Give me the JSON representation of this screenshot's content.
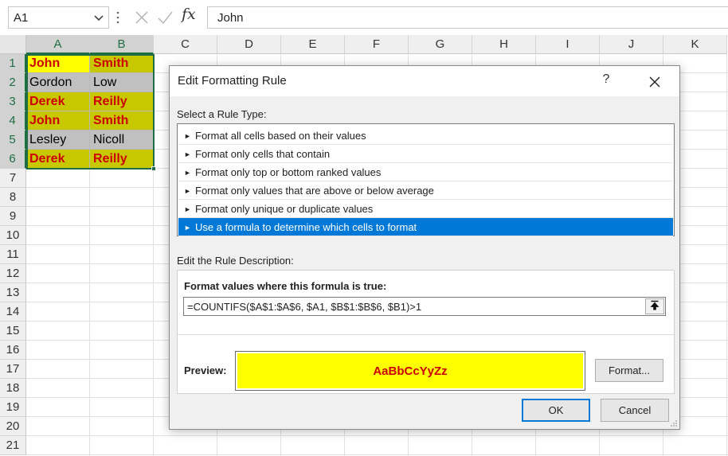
{
  "formula_bar": {
    "name_box": "A1",
    "fx_label": "fx",
    "formula_text": "John",
    "icons": [
      "chevron-down-icon",
      "vertical-dots-icon",
      "cancel-x-icon",
      "check-icon"
    ]
  },
  "sheet": {
    "columns": [
      "A",
      "B",
      "C",
      "D",
      "E",
      "F",
      "G",
      "H",
      "I",
      "J",
      "K"
    ],
    "rows": [
      "1",
      "2",
      "3",
      "4",
      "5",
      "6",
      "7",
      "8",
      "9",
      "10",
      "11",
      "12",
      "13",
      "14",
      "15",
      "16",
      "17",
      "18",
      "19",
      "20",
      "21"
    ],
    "data": [
      {
        "a": "John",
        "b": "Smith",
        "highlight": true
      },
      {
        "a": "Gordon",
        "b": "Low",
        "highlight": false
      },
      {
        "a": "Derek",
        "b": "Reilly",
        "highlight": true
      },
      {
        "a": "John",
        "b": "Smith",
        "highlight": true
      },
      {
        "a": "Lesley",
        "b": "Nicoll",
        "highlight": false
      },
      {
        "a": "Derek",
        "b": "Reilly",
        "highlight": true
      }
    ],
    "colors": {
      "active_cell_fill": "#ffff00",
      "highlight_fill": "#c8c800",
      "plain_fill": "#c0c0c0",
      "highlight_text": "#cc0000",
      "selection_border": "#1f6e43"
    }
  },
  "dialog": {
    "title": "Edit Formatting Rule",
    "help": "?",
    "select_rule_type_label": "Select a Rule Type:",
    "rule_types": [
      "Format all cells based on their values",
      "Format only cells that contain",
      "Format only top or bottom ranked values",
      "Format only values that are above or below average",
      "Format only unique or duplicate values",
      "Use a formula to determine which cells to format"
    ],
    "selected_rule_index": 5,
    "edit_description_label": "Edit the Rule Description:",
    "formula_heading": "Format values where this formula is true:",
    "formula": "=COUNTIFS($A$1:$A$6, $A1, $B$1:$B$6, $B1)>1",
    "preview_label": "Preview:",
    "preview_text": "AaBbCcYyZz",
    "preview_fill": "#ffff00",
    "preview_text_color": "#cc0000",
    "format_button": "Format...",
    "ok_button": "OK",
    "cancel_button": "Cancel",
    "accent": "#0078d7"
  }
}
